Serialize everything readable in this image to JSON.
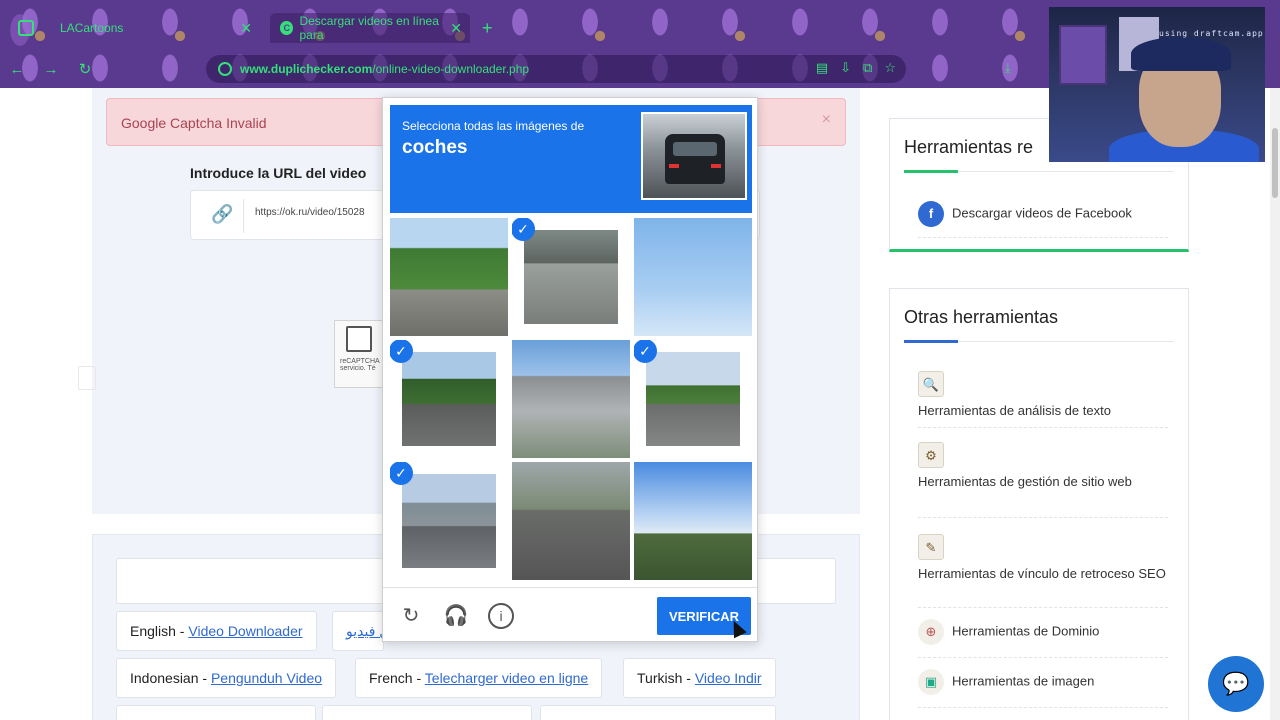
{
  "browser": {
    "tabs": [
      {
        "label": "LACartoons"
      },
      {
        "label": "Descargar videos en línea para"
      }
    ],
    "url_domain": "www.duplichecker.com",
    "url_path": "/online-video-downloader.php"
  },
  "webcam": {
    "caption": "using draftcam.app"
  },
  "alert": {
    "message": "Google Captcha Invalid",
    "close": "×"
  },
  "form": {
    "url_label": "Introduce la URL del video",
    "url_value": "https://ok.ru/video/15028"
  },
  "recaptcha_small": {
    "text1": "reCAPTCHA",
    "text2": "servicio. Té"
  },
  "captcha": {
    "instruction": "Selecciona todas las imágenes de",
    "target": "coches",
    "verify_label": "VERIFICAR",
    "tiles": [
      {
        "selected": false,
        "scene": "tree-street"
      },
      {
        "selected": true,
        "scene": "parked-cars"
      },
      {
        "selected": false,
        "scene": "traffic-light"
      },
      {
        "selected": true,
        "scene": "road-cars"
      },
      {
        "selected": false,
        "scene": "bridge"
      },
      {
        "selected": true,
        "scene": "highway-cars"
      },
      {
        "selected": true,
        "scene": "crosswalk"
      },
      {
        "selected": false,
        "scene": "street"
      },
      {
        "selected": false,
        "scene": "bridge-sky"
      }
    ]
  },
  "languages": [
    {
      "lang": "English",
      "link": "Video Downloader"
    },
    {
      "lang": "",
      "link": "بل فيديو"
    },
    {
      "lang": "Indonesian",
      "link": "Pengunduh Video"
    },
    {
      "lang": "French",
      "link": "Telecharger video en ligne"
    },
    {
      "lang": "Turkish",
      "link": "Video Indir"
    }
  ],
  "sidebar": {
    "box1_title": "Herramientas re",
    "box1_item": "Descargar videos de Facebook",
    "box2_title": "Otras herramientas",
    "items": [
      {
        "label": "Herramientas de análisis de texto"
      },
      {
        "label": "Herramientas de gestión de sitio web"
      },
      {
        "label": "Herramientas de vínculo de retroceso SEO"
      },
      {
        "label": "Herramientas de Dominio"
      },
      {
        "label": "Herramientas de imagen"
      }
    ]
  },
  "colors": {
    "accent": "#1a73e8",
    "green": "#25c26b",
    "alert_bg": "#f8d7da"
  }
}
